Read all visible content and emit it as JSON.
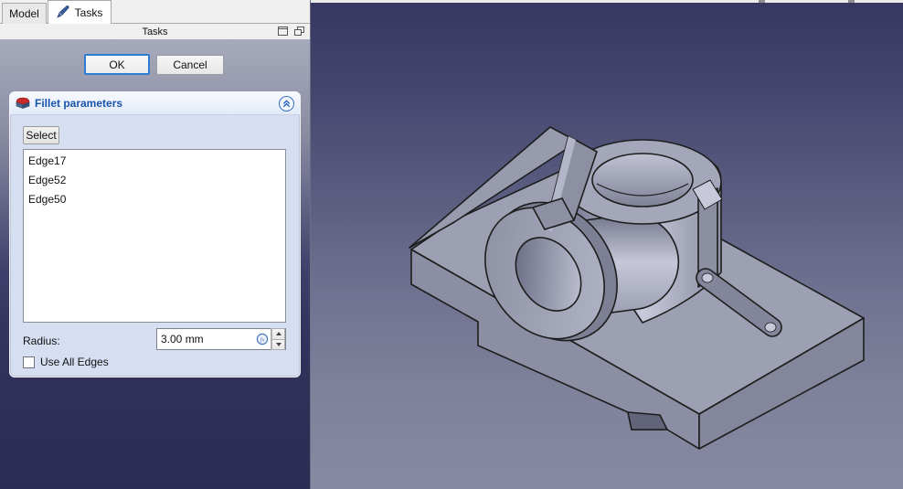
{
  "tabs": [
    {
      "label": "Model",
      "active": false
    },
    {
      "label": "Tasks",
      "active": true
    }
  ],
  "panel": {
    "title": "Tasks"
  },
  "actions": {
    "ok": "OK",
    "cancel": "Cancel"
  },
  "fillet": {
    "title": "Fillet parameters",
    "select_label": "Select",
    "edges": [
      "Edge17",
      "Edge52",
      "Edge50"
    ],
    "radius_label": "Radius:",
    "radius_value": "3.00 mm",
    "use_all_edges_label": "Use All Edges"
  },
  "icons": {
    "tasks_tab": "pen-icon",
    "header": "fillet-box-icon",
    "collapse": "double-chevron-up-icon",
    "expression": "fx-circle-icon",
    "dock": "dock-window-icon",
    "float": "float-window-icon"
  },
  "colors": {
    "accent_blue": "#2b7cd3",
    "title_blue": "#1a55ad",
    "panel_gradient_top": "#a7a9bc",
    "panel_gradient_bottom": "#2b2c54",
    "viewport_gradient_top": "#363761",
    "viewport_gradient_bottom": "#8689a1",
    "part_gray": "#9da0b3",
    "outline": "#1d1d1d"
  },
  "scene": {
    "description": "Isometric gray CAD part: base plate with groove and notch, vertical bored boss, horizontal bore with C-collar"
  }
}
